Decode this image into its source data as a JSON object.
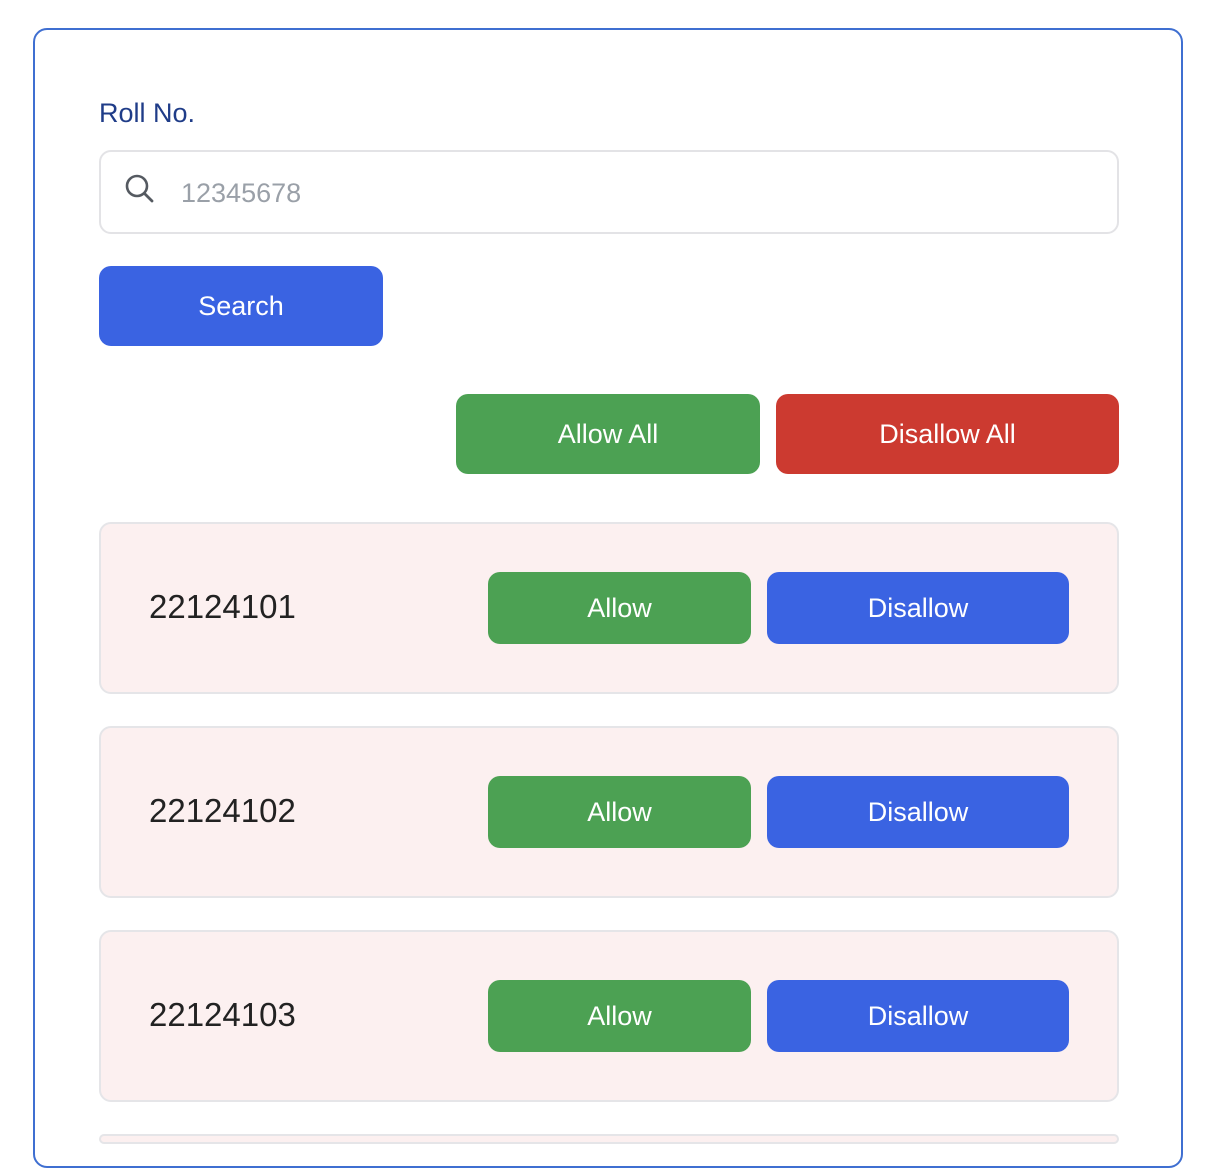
{
  "form": {
    "label": "Roll No.",
    "search_placeholder": "12345678",
    "search_value": "",
    "search_button": "Search"
  },
  "bulk_actions": {
    "allow_all": "Allow All",
    "disallow_all": "Disallow All"
  },
  "rows": [
    {
      "roll": "22124101",
      "allow": "Allow",
      "disallow": "Disallow"
    },
    {
      "roll": "22124102",
      "allow": "Allow",
      "disallow": "Disallow"
    },
    {
      "roll": "22124103",
      "allow": "Allow",
      "disallow": "Disallow"
    }
  ],
  "colors": {
    "primary": "#3a63e2",
    "success": "#4ca153",
    "danger": "#cc3a30",
    "row_bg": "#fcf0f0",
    "panel_border": "#3f6fd1",
    "label": "#1f3c88"
  },
  "icons": {
    "search": "search-icon"
  }
}
